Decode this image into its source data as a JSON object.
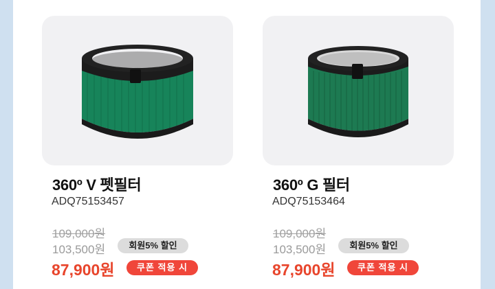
{
  "colors": {
    "background": "#cfe0f0",
    "card_image_bg": "#f1f1f3",
    "price_accent": "#e8452c",
    "coupon_badge": "#f0463a",
    "member_badge": "#dcdcdc",
    "filter_green": "#1e8a5c"
  },
  "products": [
    {
      "title": "360º V 펫필터",
      "model": "ADQ75153457",
      "original_price": "109,000원",
      "member_price": "103,500원",
      "member_badge": "회원5% 할인",
      "final_price": "87,900원",
      "coupon_badge": "쿠폰 적용 시",
      "image_icon": "air-purifier-filter"
    },
    {
      "title": "360º G 필터",
      "model": "ADQ75153464",
      "original_price": "109,000원",
      "member_price": "103,500원",
      "member_badge": "회원5% 할인",
      "final_price": "87,900원",
      "coupon_badge": "쿠폰 적용 시",
      "image_icon": "air-purifier-filter"
    }
  ]
}
